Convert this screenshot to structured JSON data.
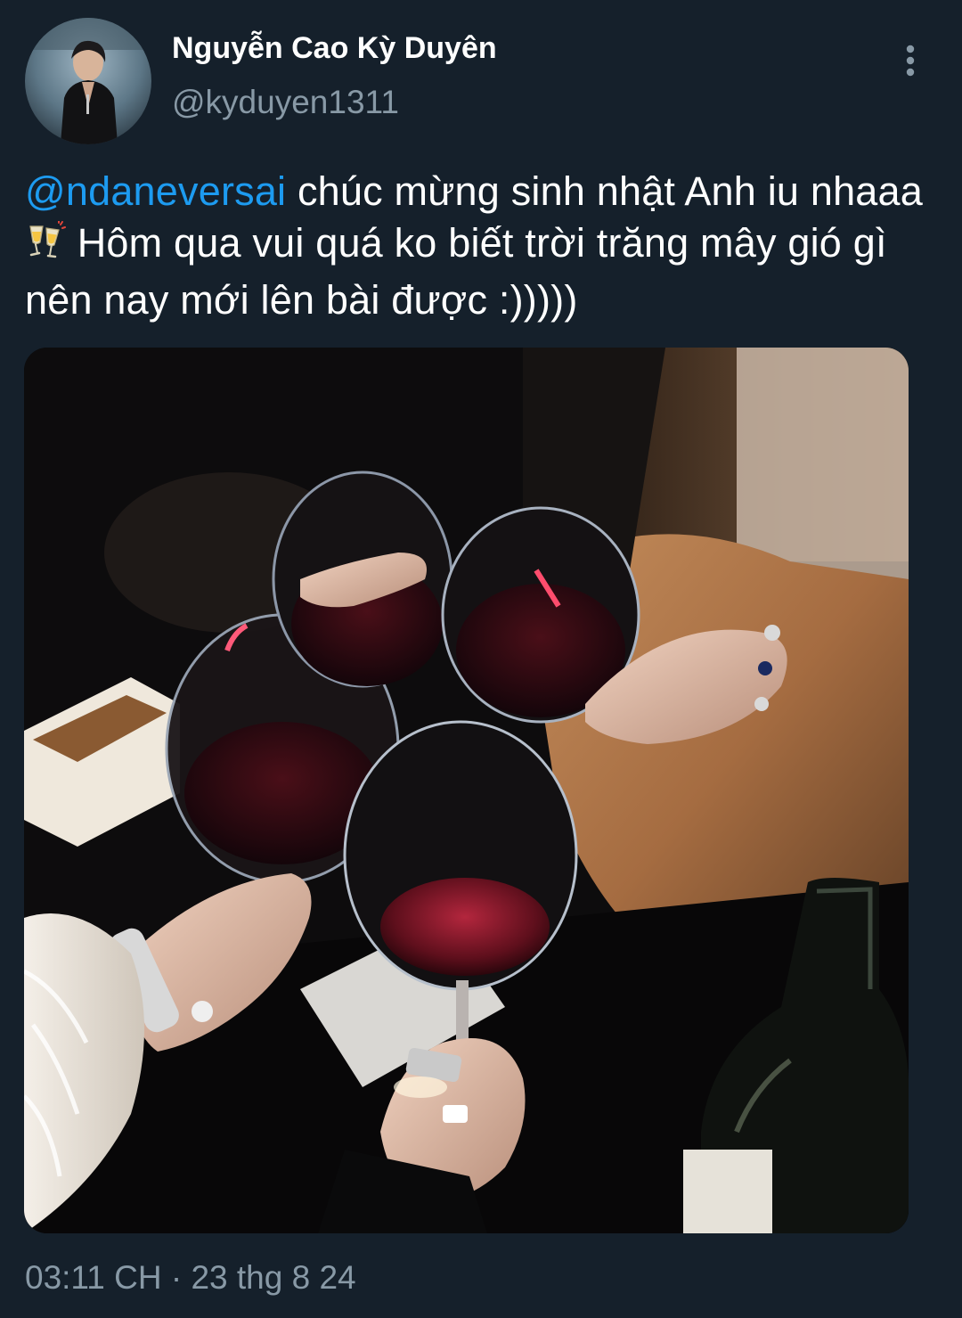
{
  "author": {
    "display_name": "Nguyễn Cao Kỳ Duyên",
    "handle": "@kyduyen1311",
    "avatar_icon": "profile-photo"
  },
  "menu": {
    "icon": "more-vertical-icon"
  },
  "tweet": {
    "mention": "@ndaneversai",
    "text_part1": " chúc mừng sinh nhật Anh iu nhaaa ",
    "emoji": "clinking-glasses",
    "text_part2": " Hôm qua vui quá ko biết trời trăng mây gió gì nên nay mới lên bài được :)))))"
  },
  "media": {
    "kind": "photo"
  },
  "meta": {
    "timestamp": "03:11 CH · 23 thg 8 24"
  },
  "colors": {
    "background": "#15202b",
    "primary_text": "#ffffff",
    "secondary_text": "#8899a6",
    "link": "#1d9bf0"
  }
}
